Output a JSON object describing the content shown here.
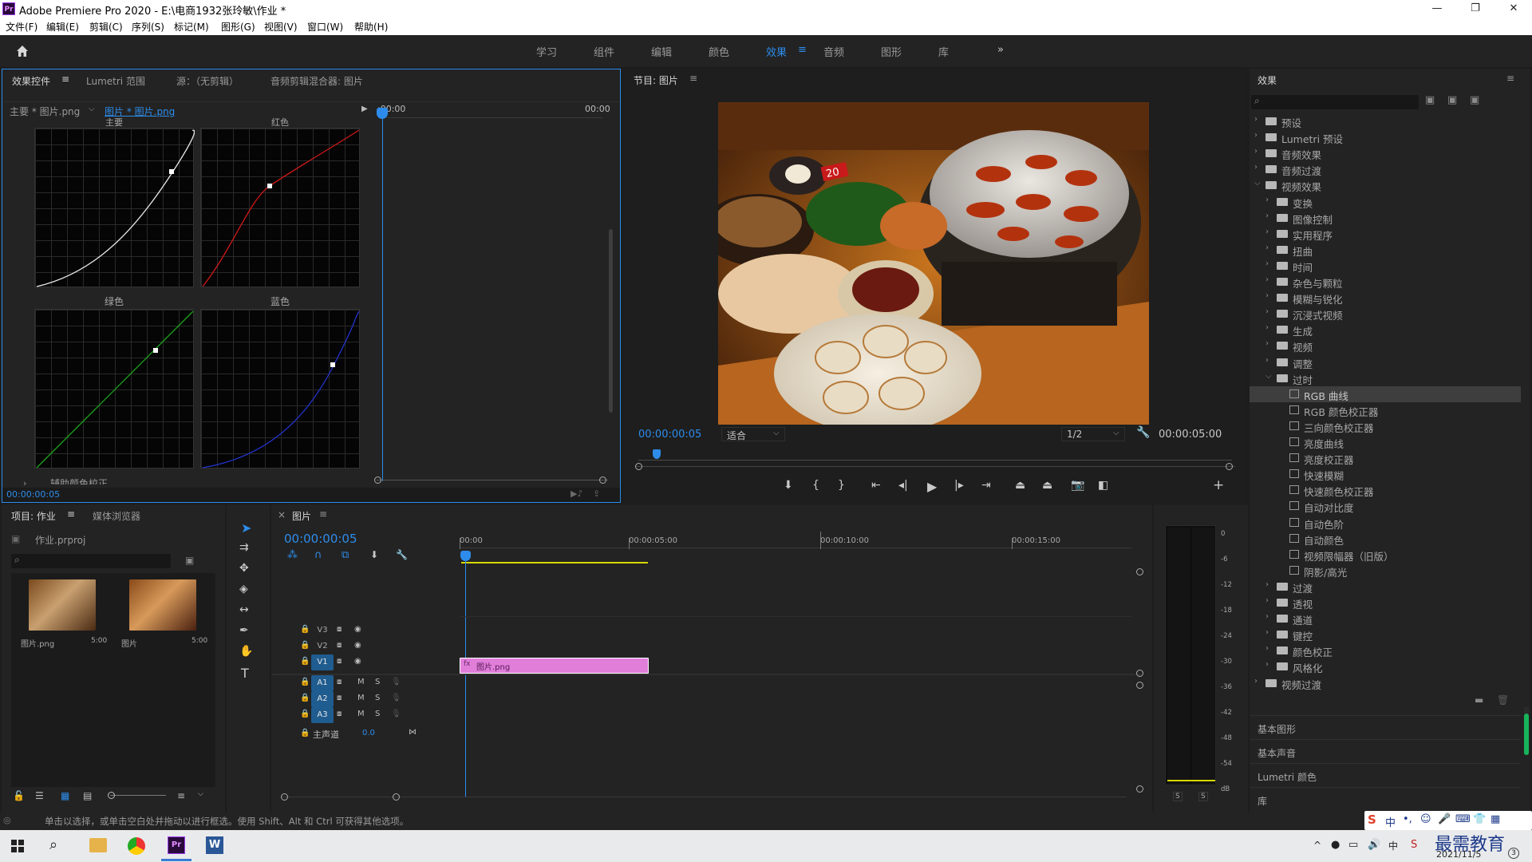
{
  "window": {
    "app_icon": "Pr",
    "title": "Adobe Premiere Pro 2020 - E:\\电商1932张玲敏\\作业 *",
    "controls": [
      "minimize-icon",
      "maximize-icon",
      "close-icon"
    ]
  },
  "menu": [
    "文件(F)",
    "编辑(E)",
    "剪辑(C)",
    "序列(S)",
    "标记(M)",
    "图形(G)",
    "视图(V)",
    "窗口(W)",
    "帮助(H)"
  ],
  "workspaces": {
    "items": [
      "学习",
      "组件",
      "编辑",
      "颜色",
      "效果",
      "音频",
      "图形",
      "库"
    ],
    "active": "效果",
    "more": "»"
  },
  "effect_controls": {
    "tabs": [
      "效果控件",
      "Lumetri 范围",
      "源：（无剪辑）",
      "音频剪辑混合器: 图片"
    ],
    "master_clip": "主要 * 图片.png",
    "clip": "图片 * 图片.png",
    "time_start": ":00:00",
    "time_end": "00:00",
    "curves": {
      "master_label": "主要",
      "red_label": "红色",
      "green_label": "绿色",
      "blue_label": "蓝色"
    },
    "aux_label": "辅助颜色校正",
    "timecode": "00:00:00:05"
  },
  "program_monitor": {
    "title": "节目: 图片",
    "timecode_current": "00:00:00:05",
    "fit": "适合",
    "resolution": "1/2",
    "timecode_duration": "00:00:05:00",
    "image_alt": "restaurant table with grill and dishes",
    "sign_text": "20"
  },
  "effects_panel": {
    "title": "效果",
    "search_placeholder": "",
    "tree": [
      {
        "label": "预设",
        "level": 0,
        "type": "folder",
        "expanded": false
      },
      {
        "label": "Lumetri 预设",
        "level": 0,
        "type": "folder",
        "expanded": false
      },
      {
        "label": "音频效果",
        "level": 0,
        "type": "folder",
        "expanded": false
      },
      {
        "label": "音频过渡",
        "level": 0,
        "type": "folder",
        "expanded": false
      },
      {
        "label": "视频效果",
        "level": 0,
        "type": "folder",
        "expanded": true
      },
      {
        "label": "变换",
        "level": 1,
        "type": "folder",
        "expanded": false
      },
      {
        "label": "图像控制",
        "level": 1,
        "type": "folder",
        "expanded": false
      },
      {
        "label": "实用程序",
        "level": 1,
        "type": "folder",
        "expanded": false
      },
      {
        "label": "扭曲",
        "level": 1,
        "type": "folder",
        "expanded": false
      },
      {
        "label": "时间",
        "level": 1,
        "type": "folder",
        "expanded": false
      },
      {
        "label": "杂色与颗粒",
        "level": 1,
        "type": "folder",
        "expanded": false
      },
      {
        "label": "模糊与锐化",
        "level": 1,
        "type": "folder",
        "expanded": false
      },
      {
        "label": "沉浸式视频",
        "level": 1,
        "type": "folder",
        "expanded": false
      },
      {
        "label": "生成",
        "level": 1,
        "type": "folder",
        "expanded": false
      },
      {
        "label": "视频",
        "level": 1,
        "type": "folder",
        "expanded": false
      },
      {
        "label": "调整",
        "level": 1,
        "type": "folder",
        "expanded": false
      },
      {
        "label": "过时",
        "level": 1,
        "type": "folder",
        "expanded": true
      },
      {
        "label": "RGB 曲线",
        "level": 2,
        "type": "effect",
        "selected": true
      },
      {
        "label": "RGB 颜色校正器",
        "level": 2,
        "type": "effect"
      },
      {
        "label": "三向颜色校正器",
        "level": 2,
        "type": "effect"
      },
      {
        "label": "亮度曲线",
        "level": 2,
        "type": "effect"
      },
      {
        "label": "亮度校正器",
        "level": 2,
        "type": "effect"
      },
      {
        "label": "快速模糊",
        "level": 2,
        "type": "effect"
      },
      {
        "label": "快速颜色校正器",
        "level": 2,
        "type": "effect"
      },
      {
        "label": "自动对比度",
        "level": 2,
        "type": "effect"
      },
      {
        "label": "自动色阶",
        "level": 2,
        "type": "effect"
      },
      {
        "label": "自动颜色",
        "level": 2,
        "type": "effect"
      },
      {
        "label": "视频限幅器（旧版）",
        "level": 2,
        "type": "effect"
      },
      {
        "label": "阴影/高光",
        "level": 2,
        "type": "effect"
      },
      {
        "label": "过渡",
        "level": 1,
        "type": "folder",
        "expanded": false
      },
      {
        "label": "透视",
        "level": 1,
        "type": "folder",
        "expanded": false
      },
      {
        "label": "通道",
        "level": 1,
        "type": "folder",
        "expanded": false
      },
      {
        "label": "键控",
        "level": 1,
        "type": "folder",
        "expanded": false
      },
      {
        "label": "颜色校正",
        "level": 1,
        "type": "folder",
        "expanded": false
      },
      {
        "label": "风格化",
        "level": 1,
        "type": "folder",
        "expanded": false
      },
      {
        "label": "视频过渡",
        "level": 0,
        "type": "folder",
        "expanded": false
      }
    ],
    "sections": [
      "基本图形",
      "基本声音",
      "Lumetri 颜色",
      "库"
    ]
  },
  "project": {
    "tabs": [
      "项目: 作业",
      "媒体浏览器"
    ],
    "file": "作业.prproj",
    "items": [
      {
        "name": "图片.png",
        "duration": "5:00"
      },
      {
        "name": "图片",
        "duration": "5:00"
      }
    ]
  },
  "timeline": {
    "title": "图片",
    "timecode": "00:00:00:05",
    "ruler": [
      "00:00",
      "00:00:05:00",
      "00:00:10:00",
      "00:00:15:00"
    ],
    "video_tracks": [
      "V3",
      "V2",
      "V1"
    ],
    "audio_tracks": [
      "A1",
      "A2",
      "A3"
    ],
    "master_label": "主声道",
    "master_value": "0.0",
    "clip_label": "图片.png",
    "m_label": "M",
    "s_label": "S"
  },
  "audio_meter": {
    "scale": [
      "0",
      "-6",
      "-12",
      "-18",
      "-24",
      "-30",
      "-36",
      "-42",
      "-48",
      "-54",
      "dB"
    ],
    "solo": [
      "S",
      "S"
    ]
  },
  "status": {
    "text": "单击以选择，或单击空白处并拖动以进行框选。使用 Shift、Alt 和 Ctrl 可获得其他选项。"
  },
  "taskbar": {
    "date": "2021/11/5",
    "watermark": "最需教育",
    "ime": "中"
  },
  "colors": {
    "accent": "#2d8ceb",
    "clip_pink": "#e07ed9",
    "red_curve": "#d01818",
    "green_curve": "#1ba61b",
    "blue_curve": "#2233cc",
    "playhead": "#2d8ceb"
  }
}
